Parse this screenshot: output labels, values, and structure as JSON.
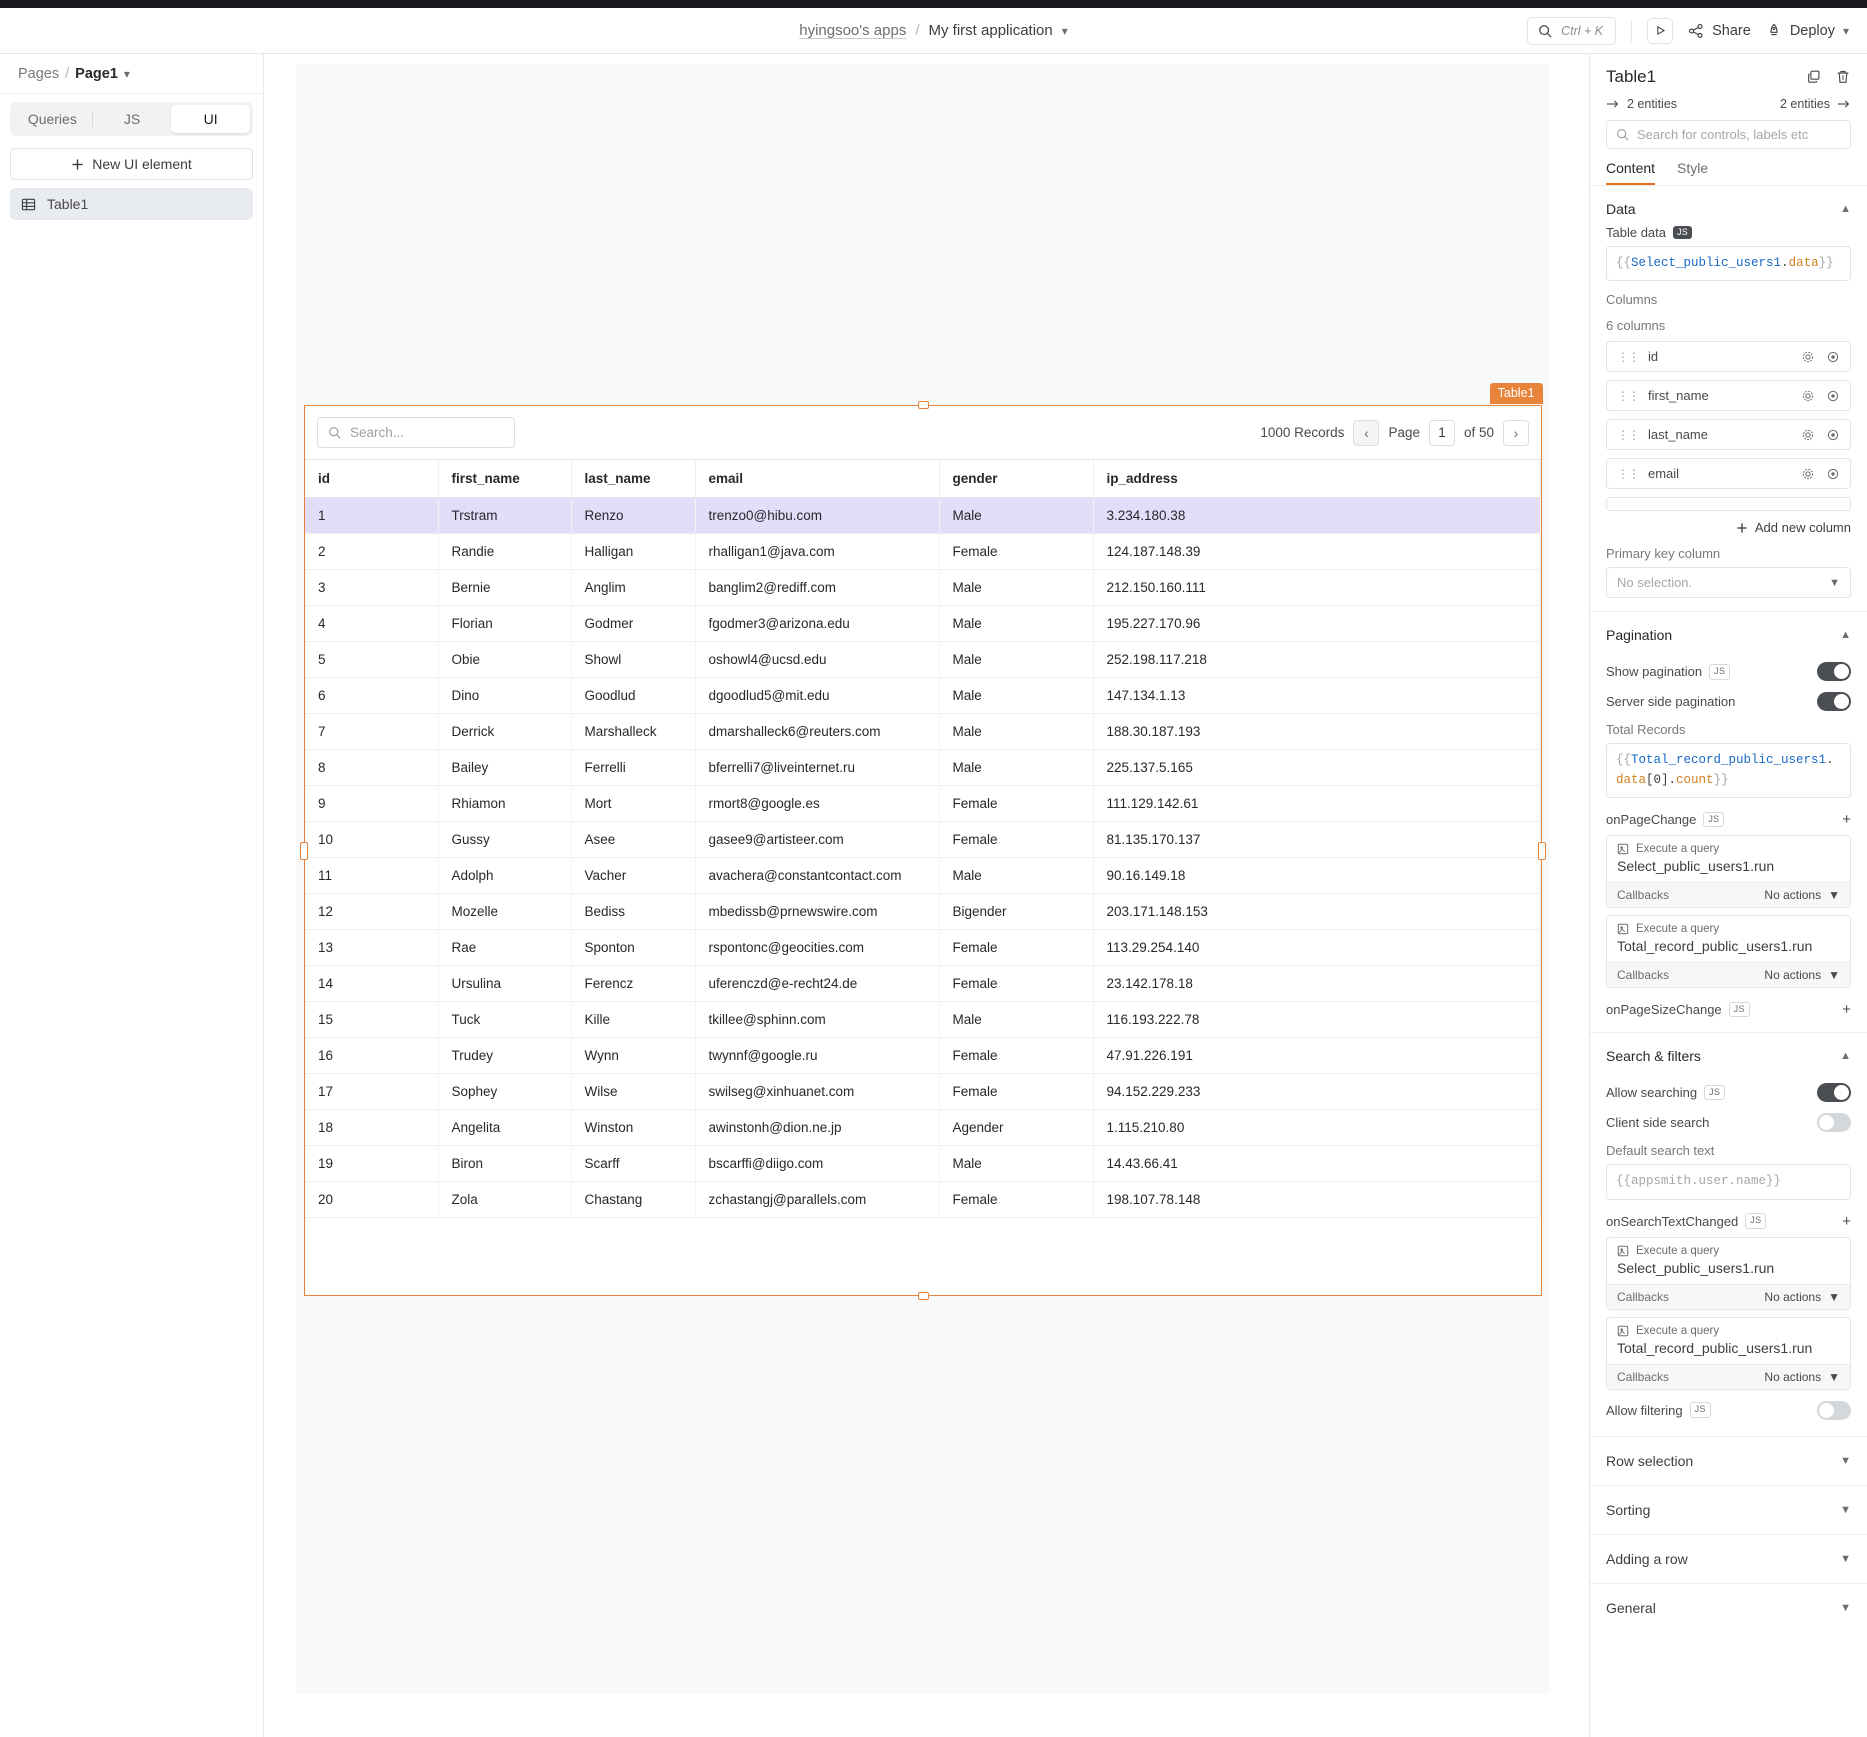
{
  "header": {
    "org": "hyingsoo's apps",
    "separator": "/",
    "app_name": "My first application",
    "search_shortcut": "Ctrl + K",
    "share_label": "Share",
    "deploy_label": "Deploy"
  },
  "sidebar": {
    "pages_label": "Pages",
    "pages_separator": "/",
    "current_page": "Page1",
    "tabs": [
      {
        "label": "Queries",
        "active": false
      },
      {
        "label": "JS",
        "active": false
      },
      {
        "label": "UI",
        "active": true
      }
    ],
    "new_element_label": "New UI element",
    "entities": [
      {
        "label": "Table1",
        "icon": "table-icon",
        "selected": true
      }
    ]
  },
  "canvas": {
    "widget_label": "Table1",
    "table": {
      "search_placeholder": "Search...",
      "records_label": "1000 Records",
      "page_label": "Page",
      "page_value": "1",
      "of_label": "of 50",
      "columns": [
        "id",
        "first_name",
        "last_name",
        "email",
        "gender",
        "ip_address"
      ],
      "rows": [
        {
          "id": "1",
          "first_name": "Trstram",
          "last_name": "Renzo",
          "email": "trenzo0@hibu.com",
          "gender": "Male",
          "ip_address": "3.234.180.38",
          "selected": true
        },
        {
          "id": "2",
          "first_name": "Randie",
          "last_name": "Halligan",
          "email": "rhalligan1@java.com",
          "gender": "Female",
          "ip_address": "124.187.148.39",
          "selected": false
        },
        {
          "id": "3",
          "first_name": "Bernie",
          "last_name": "Anglim",
          "email": "banglim2@rediff.com",
          "gender": "Male",
          "ip_address": "212.150.160.111",
          "selected": false
        },
        {
          "id": "4",
          "first_name": "Florian",
          "last_name": "Godmer",
          "email": "fgodmer3@arizona.edu",
          "gender": "Male",
          "ip_address": "195.227.170.96",
          "selected": false
        },
        {
          "id": "5",
          "first_name": "Obie",
          "last_name": "Showl",
          "email": "oshowl4@ucsd.edu",
          "gender": "Male",
          "ip_address": "252.198.117.218",
          "selected": false
        },
        {
          "id": "6",
          "first_name": "Dino",
          "last_name": "Goodlud",
          "email": "dgoodlud5@mit.edu",
          "gender": "Male",
          "ip_address": "147.134.1.13",
          "selected": false
        },
        {
          "id": "7",
          "first_name": "Derrick",
          "last_name": "Marshalleck",
          "email": "dmarshalleck6@reuters.com",
          "gender": "Male",
          "ip_address": "188.30.187.193",
          "selected": false
        },
        {
          "id": "8",
          "first_name": "Bailey",
          "last_name": "Ferrelli",
          "email": "bferrelli7@liveinternet.ru",
          "gender": "Male",
          "ip_address": "225.137.5.165",
          "selected": false
        },
        {
          "id": "9",
          "first_name": "Rhiamon",
          "last_name": "Mort",
          "email": "rmort8@google.es",
          "gender": "Female",
          "ip_address": "111.129.142.61",
          "selected": false
        },
        {
          "id": "10",
          "first_name": "Gussy",
          "last_name": "Asee",
          "email": "gasee9@artisteer.com",
          "gender": "Female",
          "ip_address": "81.135.170.137",
          "selected": false
        },
        {
          "id": "11",
          "first_name": "Adolph",
          "last_name": "Vacher",
          "email": "avachera@constantcontact.com",
          "gender": "Male",
          "ip_address": "90.16.149.18",
          "selected": false
        },
        {
          "id": "12",
          "first_name": "Mozelle",
          "last_name": "Bediss",
          "email": "mbedissb@prnewswire.com",
          "gender": "Bigender",
          "ip_address": "203.171.148.153",
          "selected": false
        },
        {
          "id": "13",
          "first_name": "Rae",
          "last_name": "Sponton",
          "email": "rspontonc@geocities.com",
          "gender": "Female",
          "ip_address": "113.29.254.140",
          "selected": false
        },
        {
          "id": "14",
          "first_name": "Ursulina",
          "last_name": "Ferencz",
          "email": "uferenczd@e-recht24.de",
          "gender": "Female",
          "ip_address": "23.142.178.18",
          "selected": false
        },
        {
          "id": "15",
          "first_name": "Tuck",
          "last_name": "Kille",
          "email": "tkillee@sphinn.com",
          "gender": "Male",
          "ip_address": "116.193.222.78",
          "selected": false
        },
        {
          "id": "16",
          "first_name": "Trudey",
          "last_name": "Wynn",
          "email": "twynnf@google.ru",
          "gender": "Female",
          "ip_address": "47.91.226.191",
          "selected": false
        },
        {
          "id": "17",
          "first_name": "Sophey",
          "last_name": "Wilse",
          "email": "swilseg@xinhuanet.com",
          "gender": "Female",
          "ip_address": "94.152.229.233",
          "selected": false
        },
        {
          "id": "18",
          "first_name": "Angelita",
          "last_name": "Winston",
          "email": "awinstonh@dion.ne.jp",
          "gender": "Agender",
          "ip_address": "1.115.210.80",
          "selected": false
        },
        {
          "id": "19",
          "first_name": "Biron",
          "last_name": "Scarff",
          "email": "bscarffi@diigo.com",
          "gender": "Male",
          "ip_address": "14.43.66.41",
          "selected": false
        },
        {
          "id": "20",
          "first_name": "Zola",
          "last_name": "Chastang",
          "email": "zchastangj@parallels.com",
          "gender": "Female",
          "ip_address": "198.107.78.148",
          "selected": false
        }
      ]
    }
  },
  "properties": {
    "widget_title": "Table1",
    "entities_left": "2 entities",
    "entities_right": "2 entities",
    "search_placeholder": "Search for controls, labels etc",
    "tabs": [
      {
        "label": "Content",
        "active": true
      },
      {
        "label": "Style",
        "active": false
      }
    ],
    "data_section": {
      "title": "Data",
      "table_data_label": "Table data",
      "js_badge": "JS",
      "table_data_value": {
        "open": "{{",
        "name": "Select_public_users1",
        "dot": ".",
        "prop": "data",
        "close": "}}"
      },
      "columns_label": "Columns",
      "columns_count": "6 columns",
      "columns": [
        {
          "name": "id"
        },
        {
          "name": "first_name"
        },
        {
          "name": "last_name"
        },
        {
          "name": "email"
        }
      ],
      "add_new_column": "Add new column",
      "primary_key_label": "Primary key column",
      "primary_key_value": "No selection."
    },
    "pagination_section": {
      "title": "Pagination",
      "show_pagination_label": "Show pagination",
      "show_pagination_on": true,
      "server_side_label": "Server side pagination",
      "server_side_on": true,
      "total_records_label": "Total Records",
      "total_records_value": {
        "open": "{{",
        "name": "Total_record_public_users1",
        "dot": ".",
        "prop": "data",
        "index": "[0]",
        "dot2": ".",
        "prop2": "count",
        "close": "}}"
      },
      "on_page_change_label": "onPageChange",
      "on_page_size_change_label": "onPageSizeChange",
      "actions": [
        {
          "kind": "Execute a query",
          "name": "Select_public_users1.run",
          "callbacks_label": "Callbacks",
          "callbacks_value": "No actions"
        },
        {
          "kind": "Execute a query",
          "name": "Total_record_public_users1.run",
          "callbacks_label": "Callbacks",
          "callbacks_value": "No actions"
        }
      ]
    },
    "search_section": {
      "title": "Search & filters",
      "allow_searching_label": "Allow searching",
      "allow_searching_on": true,
      "client_side_search_label": "Client side search",
      "client_side_search_on": false,
      "default_search_label": "Default search text",
      "default_search_placeholder": "{{appsmith.user.name}}",
      "on_search_changed_label": "onSearchTextChanged",
      "actions": [
        {
          "kind": "Execute a query",
          "name": "Select_public_users1.run",
          "callbacks_label": "Callbacks",
          "callbacks_value": "No actions"
        },
        {
          "kind": "Execute a query",
          "name": "Total_record_public_users1.run",
          "callbacks_label": "Callbacks",
          "callbacks_value": "No actions"
        }
      ],
      "allow_filtering_label": "Allow filtering",
      "allow_filtering_on": false
    },
    "collapsed_sections": [
      {
        "title": "Row selection"
      },
      {
        "title": "Sorting"
      },
      {
        "title": "Adding a row"
      },
      {
        "title": "General"
      }
    ]
  },
  "colors": {
    "accent": "#e8833a",
    "tab_accent": "#e8701a",
    "selected_row": "#e2def9",
    "toggle_on": "#4b4f54",
    "canvas": "#f8f9fa"
  }
}
